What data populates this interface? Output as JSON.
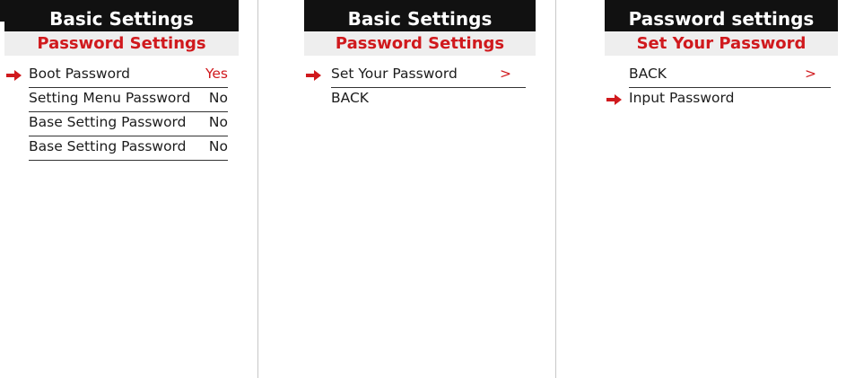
{
  "screens": [
    {
      "title": "Basic Settings",
      "subtitle": "Password Settings",
      "items": [
        {
          "label": "Boot Password",
          "value": "Yes"
        },
        {
          "label": "Setting Menu Password",
          "value": "No"
        },
        {
          "label": "Base Setting Password",
          "value": "No"
        },
        {
          "label": "Base Setting Password",
          "value": "No"
        }
      ]
    },
    {
      "title": "Basic Settings",
      "subtitle": "Password Settings",
      "items": [
        {
          "label": "Set Your Password",
          "value": ">"
        },
        {
          "label": "BACK"
        }
      ]
    },
    {
      "title": "Password settings",
      "subtitle": "Set Your Password",
      "items": [
        {
          "label": "BACK",
          "value": ">"
        },
        {
          "label": "Input Password"
        }
      ]
    }
  ],
  "colors": {
    "header_bg": "#111111",
    "accent_red": "#d0191d",
    "subheader_bg": "#eeeeee"
  }
}
